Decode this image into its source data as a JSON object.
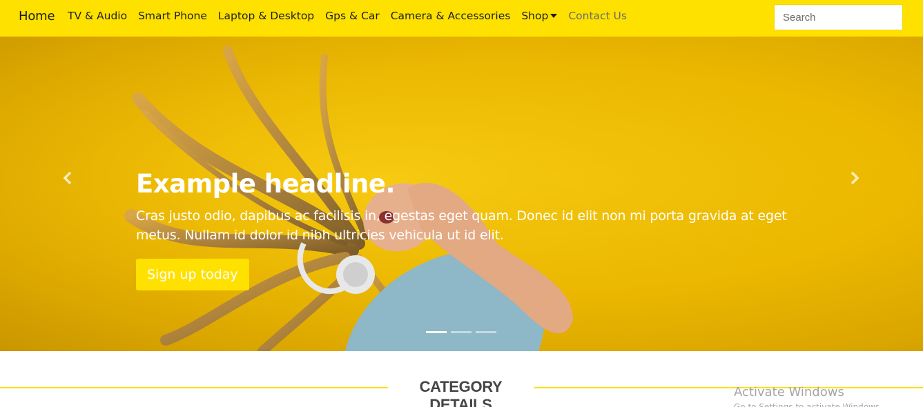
{
  "navbar": {
    "brand": "Home",
    "links": [
      {
        "label": "TV & Audio"
      },
      {
        "label": "Smart Phone"
      },
      {
        "label": "Laptop & Desktop"
      },
      {
        "label": "Gps & Car"
      },
      {
        "label": "Camera & Accessories"
      },
      {
        "label": "Shop"
      },
      {
        "label": "Contact Us"
      }
    ],
    "search_placeholder": "Search"
  },
  "hero": {
    "headline": "Example headline.",
    "lead": "Cras justo odio, dapibus ac facilisis in, egestas eget quam. Donec id elit non mi porta gravida at eget metus. Nullam id dolor id nibh ultricies vehicula ut id elit.",
    "cta_label": "Sign up today",
    "prev_icon": "chevron-left-icon",
    "next_icon": "chevron-right-icon",
    "slide_count": 3,
    "active_slide": 1
  },
  "section": {
    "title": "CATEGORY DETAILS"
  },
  "watermark": {
    "title": "Activate Windows",
    "subtitle": "Go to Settings to activate Windows."
  },
  "colors": {
    "accent": "#ffe100",
    "hero_bg": "#ecb800",
    "text_dark": "#1f1f1f",
    "muted": "#6b6b6b"
  }
}
